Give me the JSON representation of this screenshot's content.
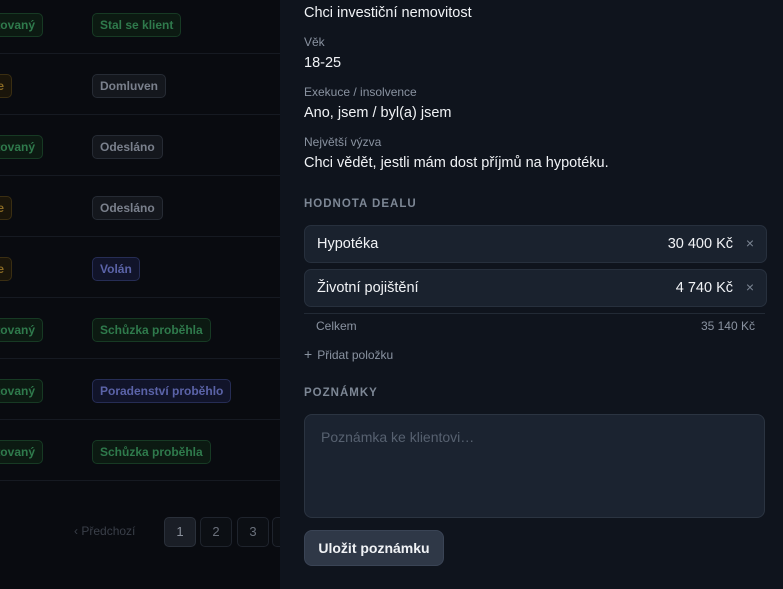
{
  "table": {
    "rows": [
      {
        "status": "ktovaný",
        "status_style": "green",
        "stage": "Stal se klient",
        "stage_style": "green"
      },
      {
        "status": "e",
        "status_style": "amber",
        "stage": "Domluven",
        "stage_style": "gray"
      },
      {
        "status": "ktovaný",
        "status_style": "green",
        "stage": "Odesláno",
        "stage_style": "gray"
      },
      {
        "status": "e",
        "status_style": "amber",
        "stage": "Odesláno",
        "stage_style": "gray"
      },
      {
        "status": "e",
        "status_style": "amber",
        "stage": "Volán",
        "stage_style": "blue"
      },
      {
        "status": "ktovaný",
        "status_style": "green",
        "stage": "Schůzka proběhla",
        "stage_style": "green"
      },
      {
        "status": "ktovaný",
        "status_style": "green",
        "stage": "Poradenství proběhlo",
        "stage_style": "blue"
      },
      {
        "status": "ktovaný",
        "status_style": "green",
        "stage": "Schůzka proběhla",
        "stage_style": "green"
      }
    ],
    "pagination": {
      "prev_label": "Předchozí",
      "pages": [
        "1",
        "2",
        "3"
      ],
      "current": "1"
    }
  },
  "detail": {
    "goal_value": "Chci investiční nemovitost",
    "age_label": "Věk",
    "age_value": "18-25",
    "execution_label": "Exekuce / insolvence",
    "execution_value": "Ano, jsem / byl(a) jsem",
    "challenge_label": "Největší výzva",
    "challenge_value": "Chci vědět, jestli mám dost příjmů na hypotéku."
  },
  "deal": {
    "section_label": "HODNOTA DEALU",
    "items": [
      {
        "name": "Hypotéka",
        "amount": "30 400 Kč",
        "remove": "×"
      },
      {
        "name": "Životní pojištění",
        "amount": "4 740 Kč",
        "remove": "×"
      }
    ],
    "total_label": "Celkem",
    "total_value": "35 140 Kč",
    "add_label": "Přidat položku",
    "add_icon": "+"
  },
  "notes": {
    "section_label": "POZNÁMKY",
    "placeholder": "Poznámka ke klientovi…",
    "value": "",
    "save_label": "Uložit poznámku"
  },
  "colors": {
    "drawer_bg": "#0f141d",
    "field_bg": "#1a222e",
    "button_bg": "#2f3847",
    "tag_green": "#2f7a4c",
    "tag_amber": "#8a6a24",
    "tag_blue": "#5b63a8"
  }
}
